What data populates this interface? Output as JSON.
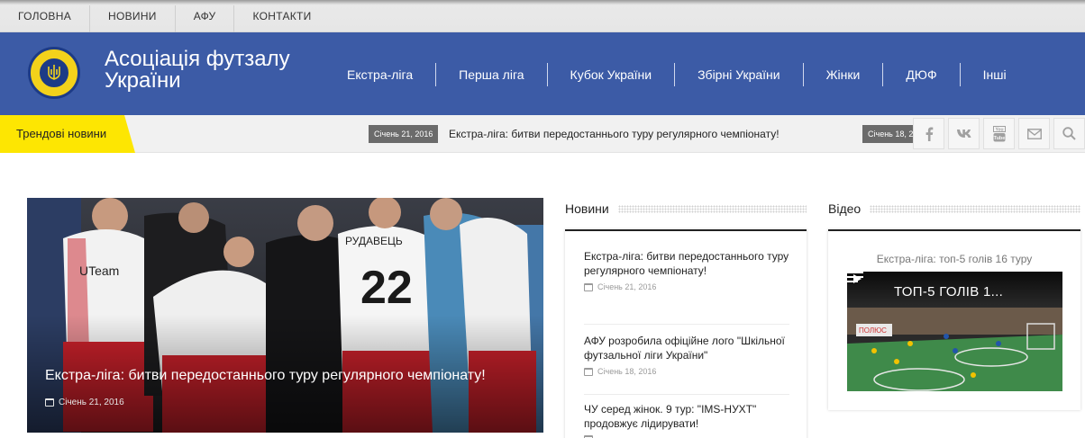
{
  "topnav": {
    "items": [
      "ГОЛОВНА",
      "НОВИНИ",
      "АФУ",
      "КОНТАКТИ"
    ]
  },
  "header": {
    "site_title": "Асоціація футзалу України",
    "nav": [
      "Екстра-ліга",
      "Перша ліга",
      "Кубок України",
      "Збірні України",
      "Жінки",
      "ДЮФ",
      "Інші"
    ]
  },
  "trending": {
    "label": "Трендові новини",
    "items": [
      {
        "date": "Січень 21, 2016",
        "title": "Екстра-ліга: битви передостаннього туру регулярного чемпіонату!"
      },
      {
        "date": "Січень 18, 2",
        "title": ""
      }
    ]
  },
  "socials": [
    "facebook-icon",
    "vk-icon",
    "youtube-icon",
    "email-icon",
    "search-icon"
  ],
  "featured": {
    "title": "Екстра-ліга: битви передостаннього туру регулярного чемпіонату!",
    "date": "Січень 21, 2016",
    "jerseys": {
      "player_name": "РУДАВЕЦЬ",
      "number": "22",
      "sponsor": "UTeam"
    }
  },
  "news": {
    "heading": "Новини",
    "items": [
      {
        "title": "Екстра-ліга: битви передостаннього туру регулярного чемпіонату!",
        "date": "Січень 21, 2016"
      },
      {
        "title": "АФУ розробила офіційне лого \"Шкільної футзальної ліги України\"",
        "date": "Січень 18, 2016"
      },
      {
        "title": "ЧУ серед жінок. 9 тур: \"IMS-НУХТ\" продовжує лідирувати!",
        "date": ""
      }
    ]
  },
  "video": {
    "heading": "Відео",
    "caption": "Екстра-ліга: топ-5 голів 16 туру",
    "thumb_title": "ТОП-5 ГОЛІВ 1...",
    "ad_text": "ПОЛЮС"
  },
  "colors": {
    "header_bg": "#3c5ba6",
    "trend_yellow": "#fde602",
    "date_badge": "#6b6b6b"
  }
}
